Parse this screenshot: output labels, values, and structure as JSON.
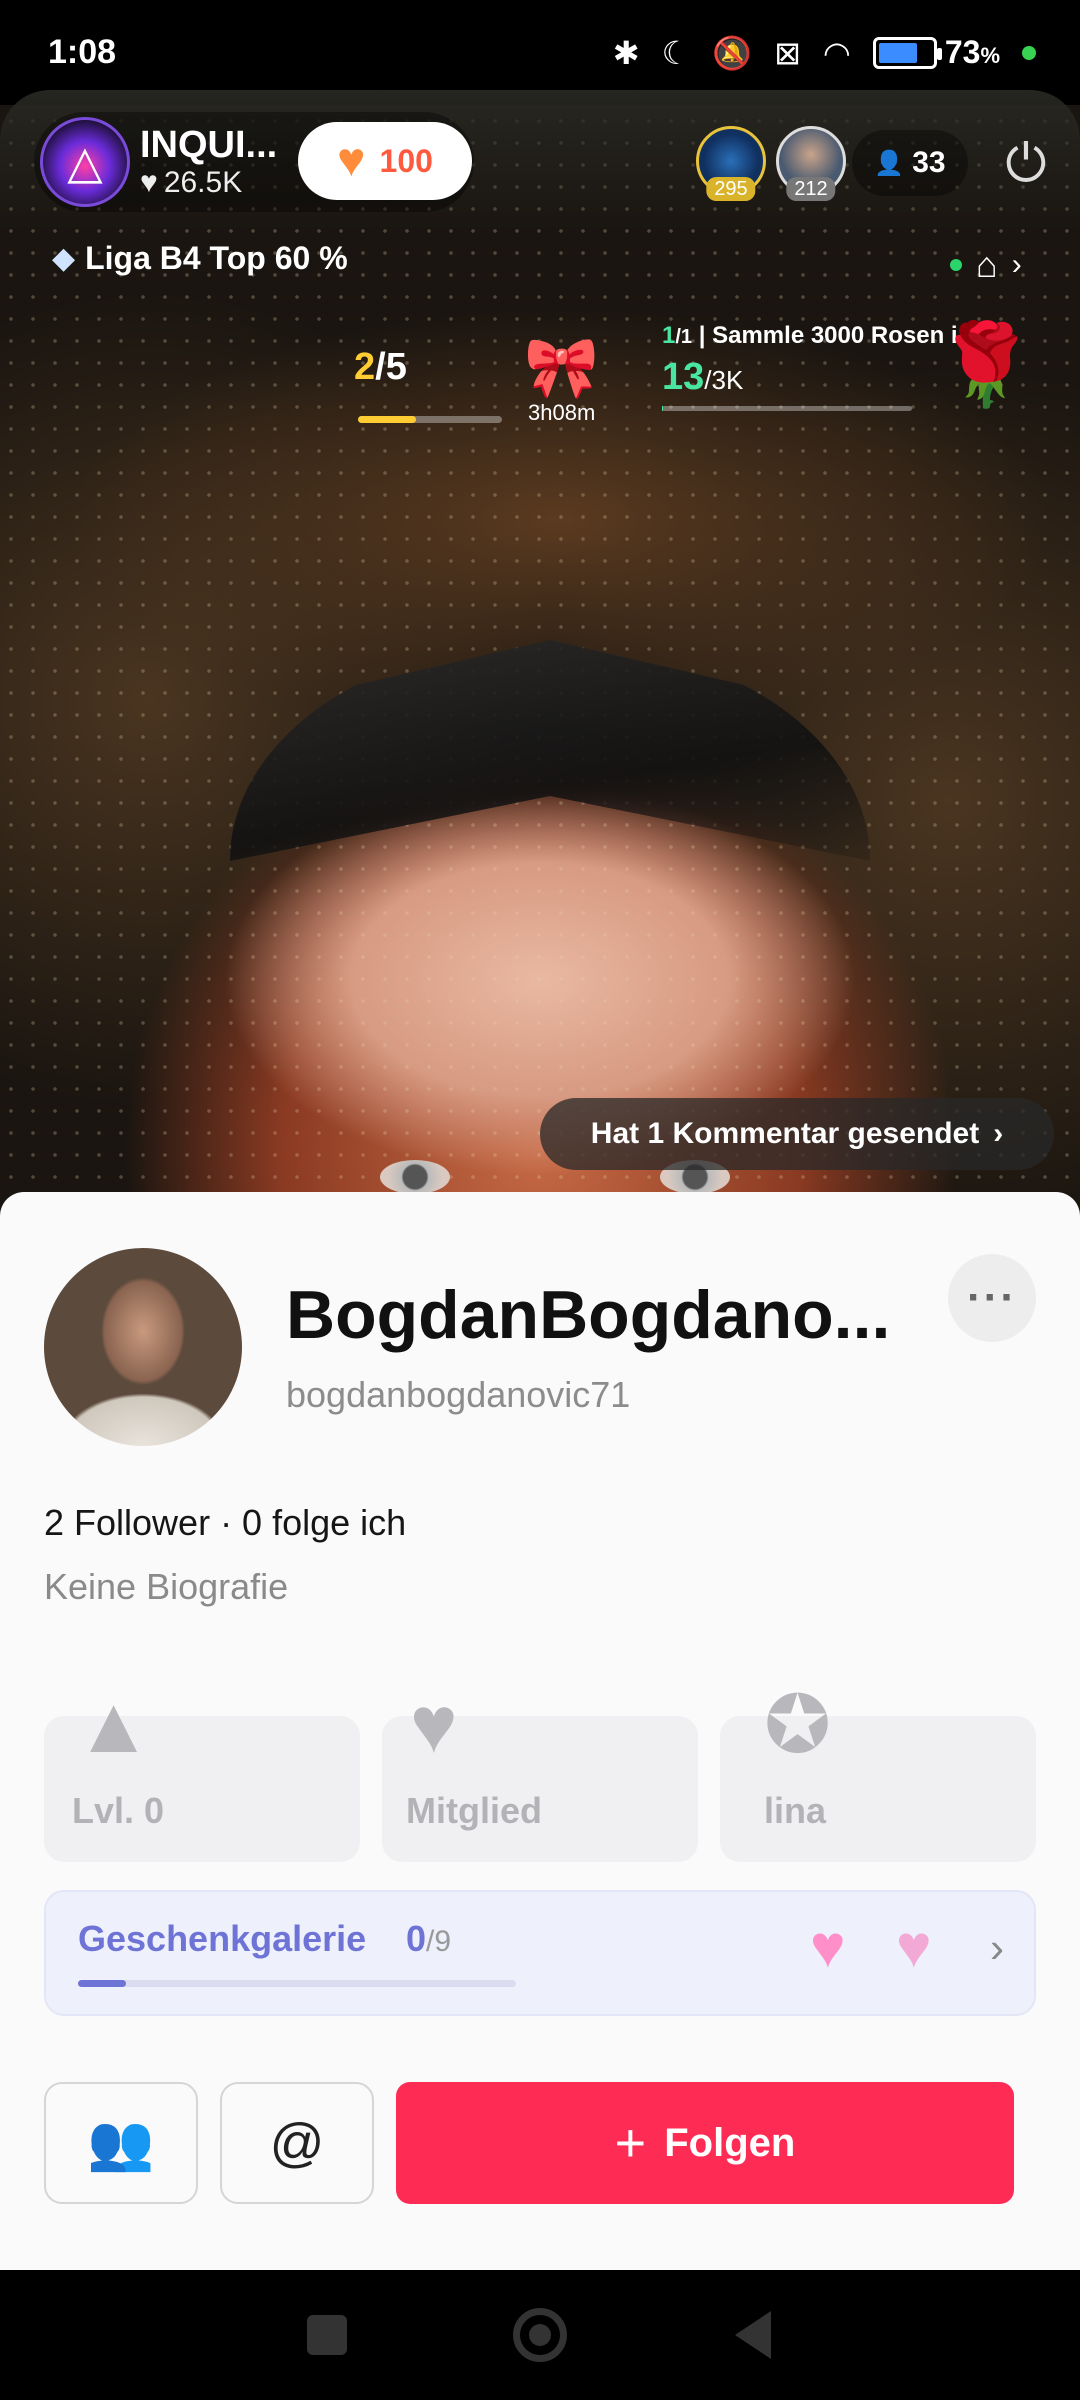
{
  "status_bar": {
    "time": "1:08",
    "battery_percent": "73",
    "battery_suffix": "%",
    "battery_level": 0.73,
    "icons": [
      "bluetooth-icon",
      "moon-icon",
      "mute-icon",
      "no-sim-icon",
      "wifi-icon",
      "battery-icon"
    ]
  },
  "live": {
    "host_name": "INQUI...",
    "host_likes": "26.5K",
    "like_count": "100",
    "top_viewers": [
      {
        "badge": "295"
      },
      {
        "badge": "212"
      }
    ],
    "viewer_count": "33",
    "league": "Liga B4 Top 60 %",
    "goal_progress": {
      "current": "2",
      "total": "/5",
      "fraction": 0.4
    },
    "gift_timer": "3h08m",
    "rose_goal": {
      "index": "1",
      "index_total": "/1",
      "title": "Sammle 3000 Rosen i",
      "current": "13",
      "target": "/3K"
    },
    "comment_notice": "Hat 1 Kommentar gesendet"
  },
  "profile": {
    "display_name": "BogdanBogdano...",
    "username": "bogdanbogdanovic71",
    "follow_stats": "2 Follower · 0 folge ich",
    "bio": "Keine Biografie",
    "badges": [
      {
        "label": "Lvl. 0",
        "icon": "paper-plane-icon"
      },
      {
        "label": "Mitglied",
        "icon": "heart-icon"
      },
      {
        "label": "lina",
        "icon": "star-badge-icon"
      }
    ],
    "gift_gallery": {
      "label": "Geschenkgalerie",
      "count": "0",
      "total": "/9",
      "progress": 0.11
    },
    "follow_label": "Folgen"
  },
  "colors": {
    "follow_button": "#fe2c55",
    "gallery_accent": "#6e73d6",
    "goal_yellow": "#ffcc33",
    "goal_green": "#48e6a0"
  }
}
